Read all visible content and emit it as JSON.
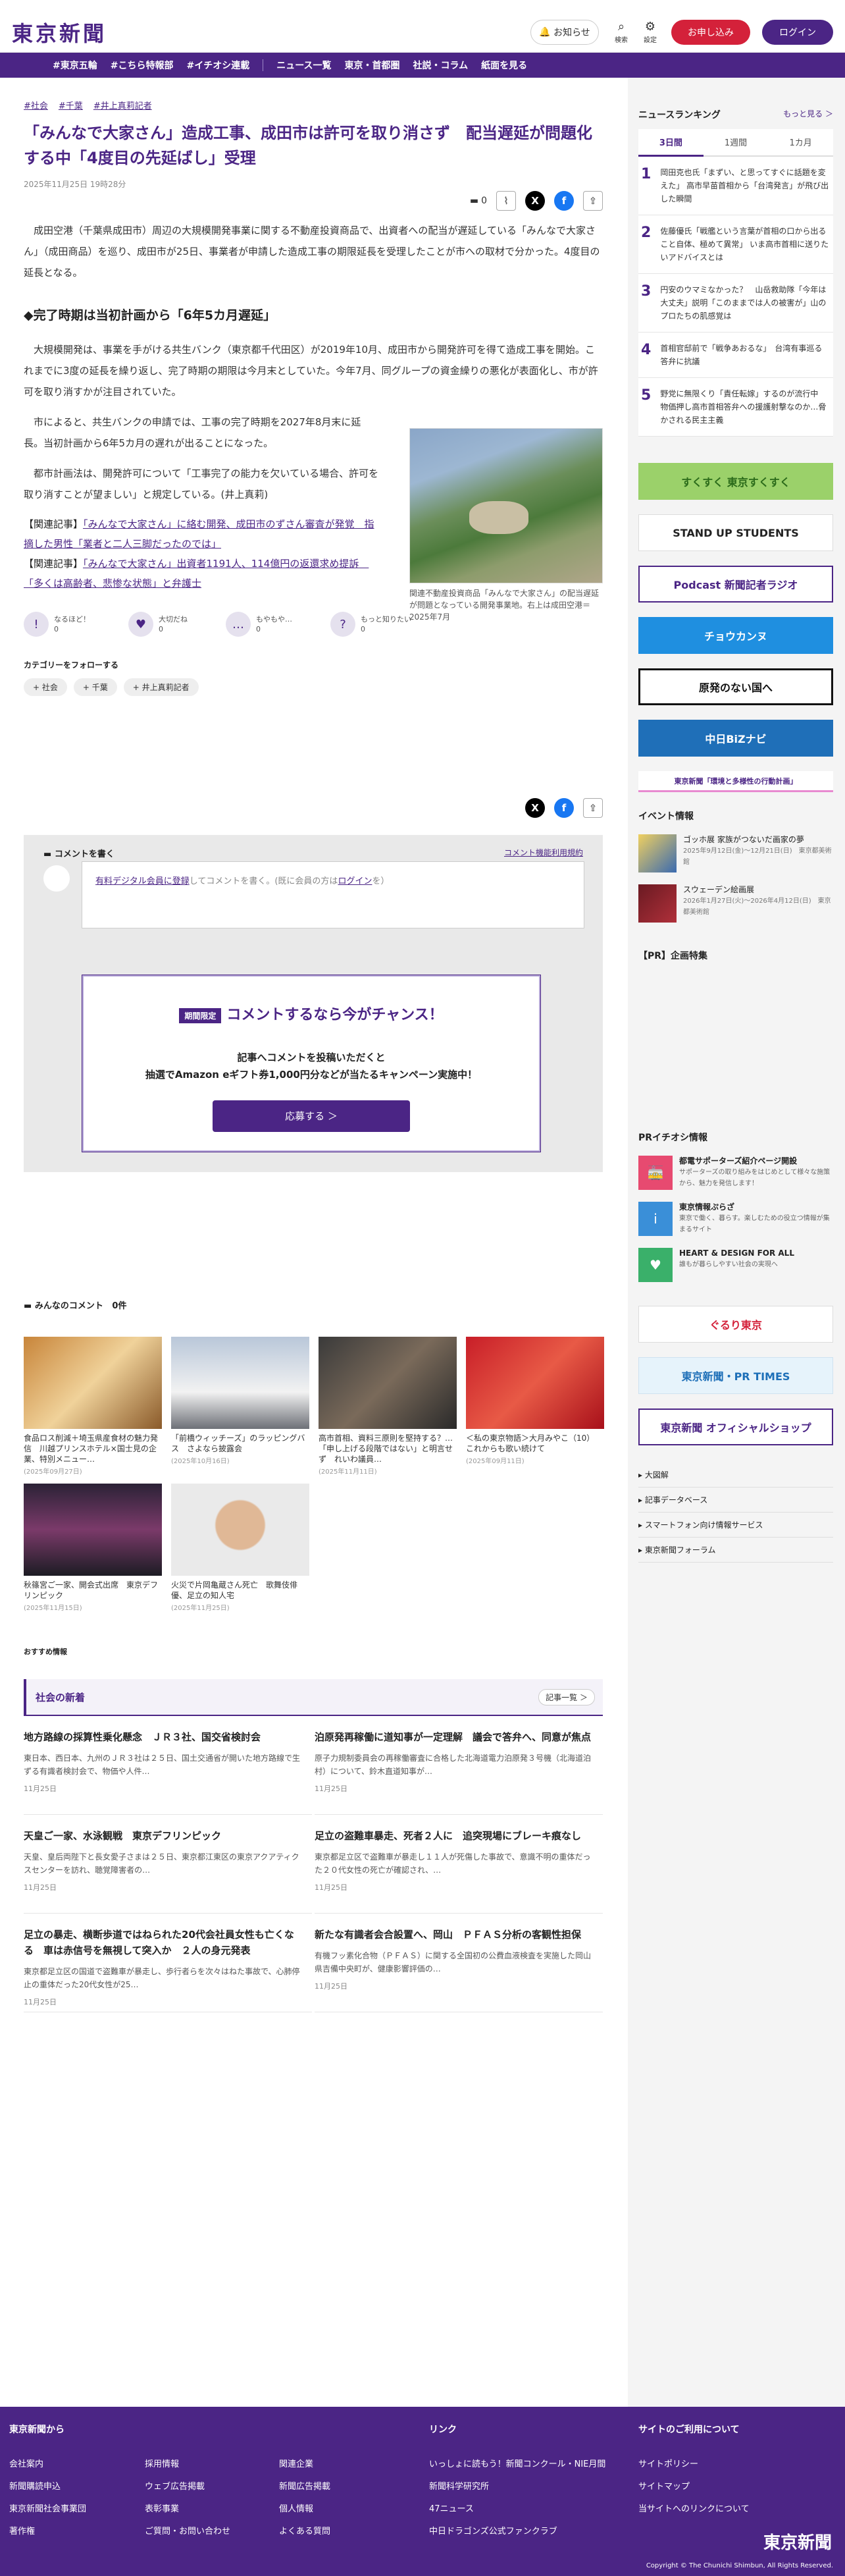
{
  "header": {
    "logo": "東京新聞",
    "notice": "お知らせ",
    "search": "検索",
    "settings": "設定",
    "subscribe": "お申し込み",
    "login": "ログイン"
  },
  "nav": [
    "#東京五輪",
    "#こちら特報部",
    "#イチオシ連載",
    "ニュース一覧",
    "東京・首都圏",
    "社説・コラム",
    "紙面を見る"
  ],
  "article": {
    "tags": [
      "#社会",
      "#千葉",
      "#井上真莉記者"
    ],
    "title": "「みんなで大家さん」造成工事、成田市は許可を取り消さず　配当遅延が問題化する中「4度目の先延ばし」受理",
    "date": "2025年11月25日 19時28分",
    "comment_count": "0",
    "p1": "成田空港（千葉県成田市）周辺の大規模開発事業に関する不動産投資商品で、出資者への配当が遅延している「みんなで大家さん」（成田商品）を巡り、成田市が25日、事業者が申請した造成工事の期限延長を受理したことが市への取材で分かった。4度目の延長となる。",
    "h2": "◆完了時期は当初計画から「6年5カ月遅延」",
    "p2": "大規模開発は、事業を手がける共生バンク（東京都千代田区）が2019年10月、成田市から開発許可を得て造成工事を開始。これまでに3度の延長を繰り返し、完了時期の期限は今月末としていた。今年7月、同グループの資金繰りの悪化が表面化し、市が許可を取り消すかが注目されていた。",
    "p3": "市によると、共生バンクの申請では、工事の完了時期を2027年8月末に延長。当初計画から6年5カ月の遅れが出ることになった。",
    "p4": "都市計画法は、開発許可について「工事完了の能力を欠いている場合、許可を取り消すことが望ましい」と規定している。(井上真莉)",
    "rel1_label": "【関連記事】",
    "rel1": "「みんなで大家さん」に絡む開発、成田市のずさん審査が発覚　指摘した男性「業者と二人三脚だったのでは」",
    "rel2_label": "【関連記事】",
    "rel2": "「みんなで大家さん」出資者1191人、114億円の返還求め提訴　「多くは高齢者、悲惨な状態」と弁護士",
    "figcap": "関連不動産投資商品「みんなで大家さん」の配当遅延が問題となっている開発事業地。右上は成田空港＝2025年7月"
  },
  "reactions": [
    {
      "label": "なるほど！",
      "count": "0",
      "icon": "!"
    },
    {
      "label": "大切だね",
      "count": "0",
      "icon": "♥"
    },
    {
      "label": "もやもや…",
      "count": "0",
      "icon": "…"
    },
    {
      "label": "もっと知りたい",
      "count": "0",
      "icon": "?"
    }
  ],
  "follow": {
    "title": "カテゴリーをフォローする",
    "chips": [
      "+ 社会",
      "+ 千葉",
      "+ 井上真莉記者"
    ]
  },
  "comment": {
    "write": "コメントを書く",
    "rules": "コメント機能利用規約",
    "placeholder_a": "有料デジタル会員に登録",
    "placeholder_b": "してコメントを書く。(既に会員の方は",
    "placeholder_c": "ログイン",
    "placeholder_d": "を）",
    "camp_badge": "期間限定",
    "camp_title": "コメントするなら今がチャンス！",
    "camp_l1": "記事へコメントを投稿いただくと",
    "camp_l2": "抽選でAmazon eギフト券1,000円分などが当たるキャンペーン実施中！",
    "camp_btn": "応募する ＞",
    "list": "みんなのコメント",
    "list_count": "0件"
  },
  "cards": [
    {
      "t": "食品ロス削減＋埼玉県産食材の魅力発信　川越プリンスホテル×国士見の企業、特別メニュー…",
      "d": "(2025年09月27日)"
    },
    {
      "t": "「前橋ウィッチーズ」のラッピングバス　さよなら披露会",
      "d": "(2025年10月16日)"
    },
    {
      "t": "高市首相、資料三原則を堅持する？…「申し上げる段階ではない」と明言せず　れいわ議員…",
      "d": "(2025年11月11日)"
    },
    {
      "t": "＜私の東京物語＞大月みやこ（10）　これからも歌い続けて",
      "d": "(2025年09月11日)"
    },
    {
      "t": "秋篠宮ご一家、開会式出席　東京デフリンピック",
      "d": "(2025年11月15日)"
    },
    {
      "t": "火災で片岡亀蔵さん死亡　歌舞伎俳優、足立の知人宅",
      "d": "(2025年11月25日)"
    }
  ],
  "recommend": "おすすめ情報",
  "section": {
    "title": "社会の新着",
    "more": "記事一覧 ＞",
    "items": [
      {
        "h": "地方路線の採算性乗化懸念　ＪＲ３社、国交省検討会",
        "p": "東日本、西日本、九州のＪＲ３社は２５日、国土交通省が開いた地方路線で生ずる有識者検討会で、物価や人件…",
        "d": "11月25日"
      },
      {
        "h": "泊原発再稼働に道知事が一定理解　議会で答弁へ、同意が焦点",
        "p": "原子力規制委員会の再稼働審査に合格した北海道電力泊原発３号機（北海道泊村）について、鈴木直道知事が…",
        "d": "11月25日"
      },
      {
        "h": "天皇ご一家、水泳観戦　東京デフリンピック",
        "p": "天皇、皇后両陛下と長女愛子さまは２５日、東京都江東区の東京アクアティクスセンターを訪れ、聴覚障害者の…",
        "d": "11月25日"
      },
      {
        "h": "足立の盗難車暴走、死者２人に　追突現場にブレーキ痕なし",
        "p": "東京都足立区で盗難車が暴走し１１人が死傷した事故で、意識不明の重体だった２０代女性の死亡が確認され、…",
        "d": "11月25日"
      },
      {
        "h": "足立の暴走、横断歩道ではねられた20代会社員女性も亡くなる　車は赤信号を無視して突入か　２人の身元発表",
        "p": "東京都足立区の国道で盗難車が暴走し、歩行者らを次々はねた事故で、心肺停止の重体だった20代女性が25…",
        "d": "11月25日"
      },
      {
        "h": "新たな有識者会合設置へ、岡山　ＰＦＡＳ分析の客観性担保",
        "p": "有機フッ素化合物（ＰＦＡＳ）に関する全国初の公費血液検査を実施した岡山県吉備中央町が、健康影響評価の…",
        "d": "11月25日"
      }
    ]
  },
  "sidebar": {
    "ranking_title": "ニュースランキング",
    "ranking_more": "もっと見る ＞",
    "tabs": [
      "3日間",
      "1週間",
      "1カ月"
    ],
    "ranking": [
      {
        "n": "1",
        "t": "岡田克也氏「まずい、と思ってすぐに話題を変えた」 高市早苗首相から「台湾発言」が飛び出した瞬間"
      },
      {
        "n": "2",
        "t": "佐藤優氏「戦艦という言葉が首相の口から出ること自体、極めて異常」 いま高市首相に送りたいアドバイスとは"
      },
      {
        "n": "3",
        "t": "円安のウマミなかった？　山岳救助隊「今年は大丈夫」説明「このままでは人の被害が」山のプロたちの肌感覚は"
      },
      {
        "n": "4",
        "t": "首相官邸前で「戦争あおるな」　台湾有事巡る答弁に抗議"
      },
      {
        "n": "5",
        "t": "野党に無限くり「責任転嫁」するのが流行中　物価押し高市首相答弁への援護射撃なのか…脅かされる民主主義"
      }
    ],
    "banners": [
      "すくすく 東京すくすく",
      "STAND UP STUDENTS",
      "Podcast 新聞記者ラジオ",
      "チョウカンヌ",
      "原発のない国へ",
      "中日BiZナビ",
      "東京新聞「環境と多様性の行動計画」"
    ],
    "events_title": "イベント情報",
    "events": [
      {
        "t": "ゴッホ展 家族がつないだ画家の夢",
        "s": "2025年9月12日(金)～12月21日(日)　東京都美術館"
      },
      {
        "t": "スウェーデン絵画展",
        "s": "2026年1月27日(火)～2026年4月12日(日)　東京都美術館"
      }
    ],
    "pr_title": "【PR】企画特集",
    "pr_info_title": "PRイチオシ情報",
    "pr_info": [
      {
        "t": "都電サポーターズ紹介ページ開設",
        "s": "サポーターズの取り組みをはじめとして様々な施策から、魅力を発信します！",
        "c": "#e74a70"
      },
      {
        "t": "東京情報ぷらざ",
        "s": "東京で働く、暮らす。楽しむための役立つ情報が集まるサイト",
        "c": "#3a8fd8"
      },
      {
        "t": "HEART & DESIGN FOR ALL",
        "s": "誰もが暮らしやすい社会の実現へ",
        "c": "#3ab06a"
      }
    ],
    "pr_banners": [
      "ぐるり東京",
      "東京新聞・PR TIMES",
      "東京新聞 オフィシャルショップ"
    ],
    "links": [
      "大図解",
      "記事データベース",
      "スマートフォン向け情報サービス",
      "東京新聞フォーラム"
    ]
  },
  "footer": {
    "h1": "東京新聞から",
    "h2": "リンク",
    "h3": "サイトのご利用について",
    "c1": [
      "会社案内",
      "新聞購読申込",
      "東京新聞社会事業団",
      "著作権"
    ],
    "c2": [
      "採用情報",
      "ウェブ広告掲載",
      "表彰事業",
      "ご質問・お問い合わせ"
    ],
    "c3": [
      "関連企業",
      "新聞広告掲載",
      "個人情報",
      "よくある質問"
    ],
    "c4": [
      "いっしょに読もう！新聞コンクール・NIE月間",
      "新聞科学研究所",
      "47ニュース",
      "中日ドラゴンズ公式ファンクラブ"
    ],
    "c5": [
      "サイトポリシー",
      "サイトマップ",
      "当サイトへのリンクについて"
    ],
    "logo": "東京新聞",
    "copy": "Copyright © The Chunichi Shimbun, All Rights Reserved."
  }
}
